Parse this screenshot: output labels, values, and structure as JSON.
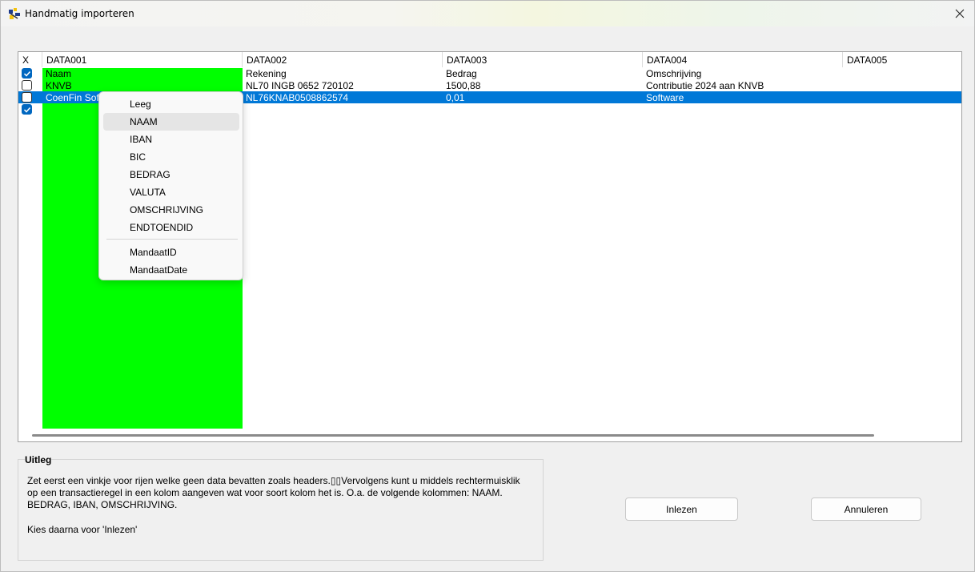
{
  "window": {
    "title": "Handmatig importeren"
  },
  "grid": {
    "check_header": "X",
    "columns": [
      "DATA001",
      "DATA002",
      "DATA003",
      "DATA004",
      "DATA005"
    ],
    "rows": [
      {
        "checked": true,
        "cells": [
          "Naam",
          "Rekening",
          "Bedrag",
          "Omschrijving",
          ""
        ]
      },
      {
        "checked": false,
        "cells": [
          "KNVB",
          "NL70 INGB 0652 720102",
          "1500,88",
          "Contributie 2024 aan KNVB",
          ""
        ]
      },
      {
        "checked": false,
        "cells": [
          "CoenFin Sof",
          "NL76KNAB0508862574",
          "0,01",
          "Software",
          ""
        ],
        "selected": true
      },
      {
        "checked": true,
        "cells": [
          "",
          "",
          "",
          "",
          ""
        ]
      }
    ]
  },
  "context_menu": {
    "items": [
      "Leeg",
      "NAAM",
      "IBAN",
      "BIC",
      "BEDRAG",
      "VALUTA",
      "OMSCHRIJVING",
      "ENDTOENDID"
    ],
    "items_after_separator": [
      "MandaatID",
      "MandaatDate"
    ],
    "hovered": "NAAM"
  },
  "uitleg": {
    "legend": "Uitleg",
    "text": "Zet eerst een vinkje voor rijen welke geen data bevatten zoals headers.▯▯Vervolgens kunt u middels rechtermuisklik op een transactieregel in een kolom aangeven wat voor soort kolom het is. O.a. de volgende kolommen: NAAM. BEDRAG, IBAN, OMSCHRIJVING.",
    "text2": "Kies daarna voor 'Inlezen'"
  },
  "buttons": {
    "read_label": "Inlezen",
    "cancel_label": "Annuleren"
  },
  "colors": {
    "selection": "#0078d7",
    "green_column": "#00ff00",
    "checkbox": "#0067c0"
  },
  "icons": {
    "title_icon": "app-icon",
    "close": "close-icon"
  }
}
